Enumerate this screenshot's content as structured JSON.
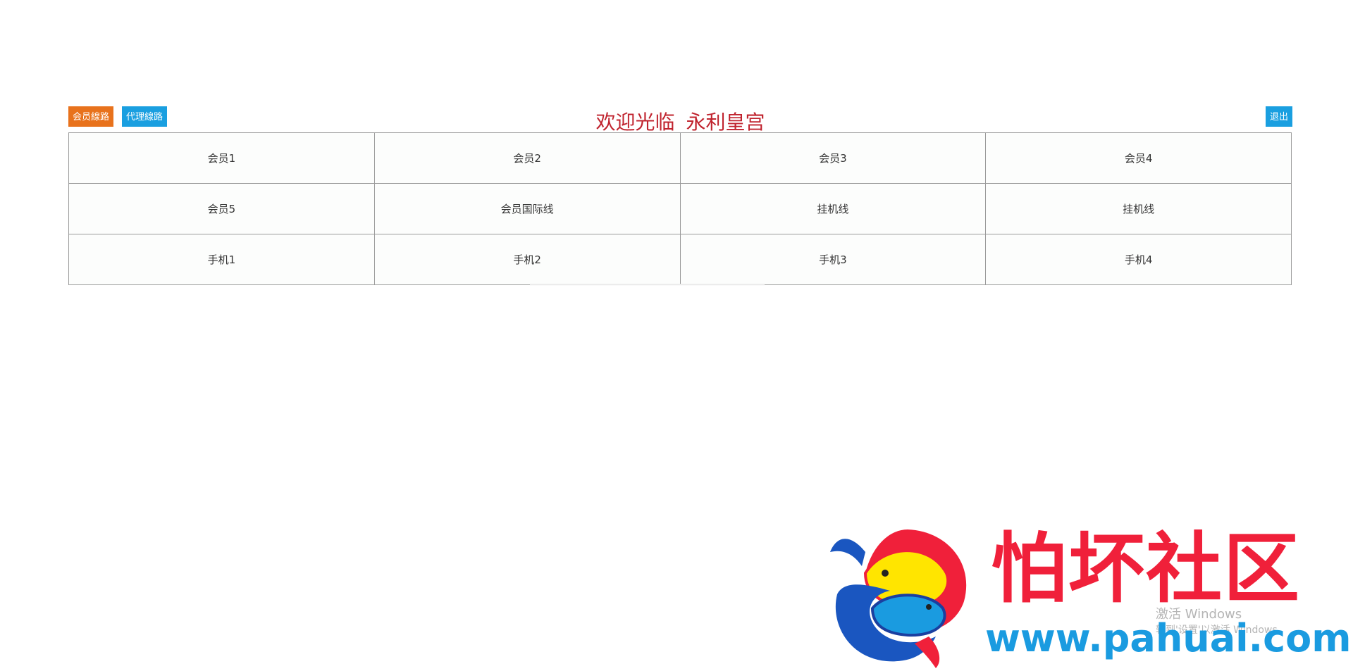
{
  "header": {
    "member_lines_label": "会员線路",
    "agent_lines_label": "代理線路",
    "welcome_text": "欢迎光临",
    "site_name": "永利皇宫",
    "logout_label": "退出"
  },
  "grid": {
    "rows": [
      [
        "会员1",
        "会员2",
        "会员3",
        "会员4"
      ],
      [
        "会员5",
        "会员国际线",
        "挂机线",
        "挂机线"
      ],
      [
        "手机1",
        "手机2",
        "手机3",
        "手机4"
      ]
    ]
  },
  "watermark": {
    "logo_text": "怕坏社区",
    "logo_url": "www.pahuai.com",
    "windows_activate_line1": "激活 Windows",
    "windows_activate_line2": "转到'设置'以激活 Windows。"
  },
  "colors": {
    "member_button": "#e8721c",
    "agent_button": "#1a9fe0",
    "logout_button": "#1a9fe0",
    "welcome_text": "#c0232e",
    "logo_red": "#f0203a",
    "logo_blue": "#1a9be0"
  }
}
